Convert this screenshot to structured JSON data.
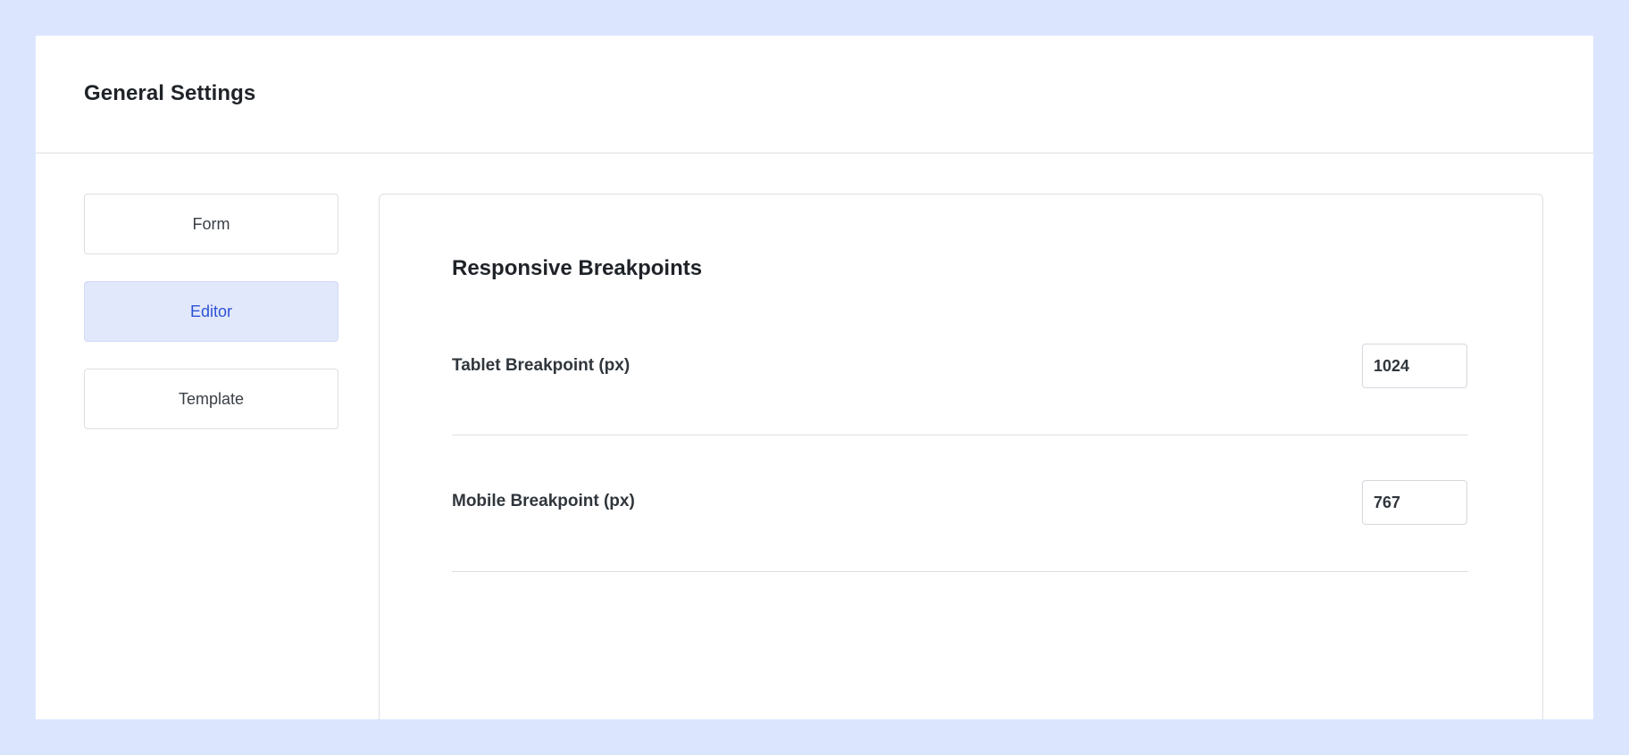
{
  "header": {
    "title": "General Settings"
  },
  "sidebar": {
    "items": [
      {
        "label": "Form",
        "active": false
      },
      {
        "label": "Editor",
        "active": true
      },
      {
        "label": "Template",
        "active": false
      }
    ]
  },
  "main": {
    "section_title": "Responsive Breakpoints",
    "fields": [
      {
        "label": "Tablet Breakpoint (px)",
        "value": "1024"
      },
      {
        "label": "Mobile Breakpoint (px)",
        "value": "767"
      }
    ]
  },
  "colors": {
    "background": "#dbe6fe",
    "active_nav_bg": "#e2e8fb",
    "active_nav_text": "#2c52d6"
  }
}
